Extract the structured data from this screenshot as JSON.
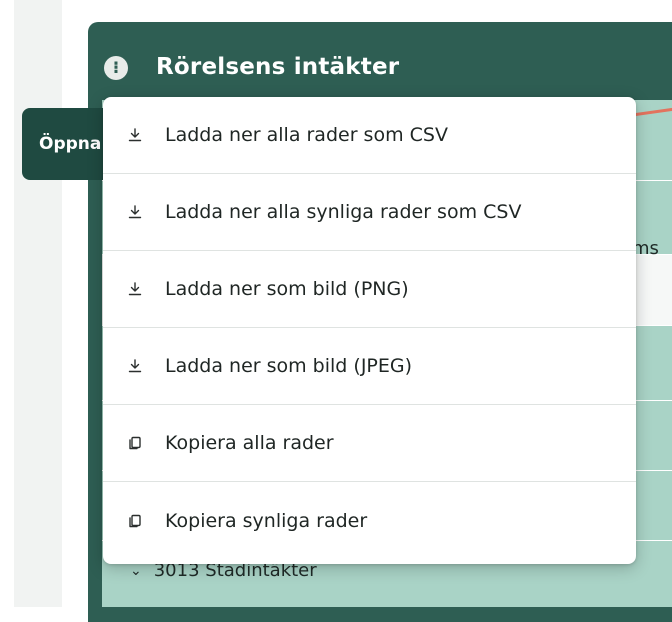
{
  "panel": {
    "title": "Rörelsens intäkter",
    "info_icon": "⁝"
  },
  "open_button": {
    "label": "Öppna"
  },
  "table": {
    "column_partial": "ms",
    "bottom_row": {
      "chevron": "⌄",
      "label": "3013 Stadintäkter"
    }
  },
  "menu": {
    "items": [
      {
        "label": "Ladda ner alla rader som CSV",
        "icon": "download-icon"
      },
      {
        "label": "Ladda ner alla synliga rader som CSV",
        "icon": "download-icon"
      },
      {
        "label": "Ladda ner som bild (PNG)",
        "icon": "download-icon"
      },
      {
        "label": "Ladda ner som bild (JPEG)",
        "icon": "download-icon"
      },
      {
        "label": "Kopiera alla rader",
        "icon": "copy-icon"
      },
      {
        "label": "Kopiera synliga rader",
        "icon": "copy-icon"
      }
    ]
  },
  "colors": {
    "panel_header": "#2e5e53",
    "panel_body": "#a9d3c6",
    "open_button": "#1f4a41",
    "annotation_arrow": "#e3735e"
  }
}
